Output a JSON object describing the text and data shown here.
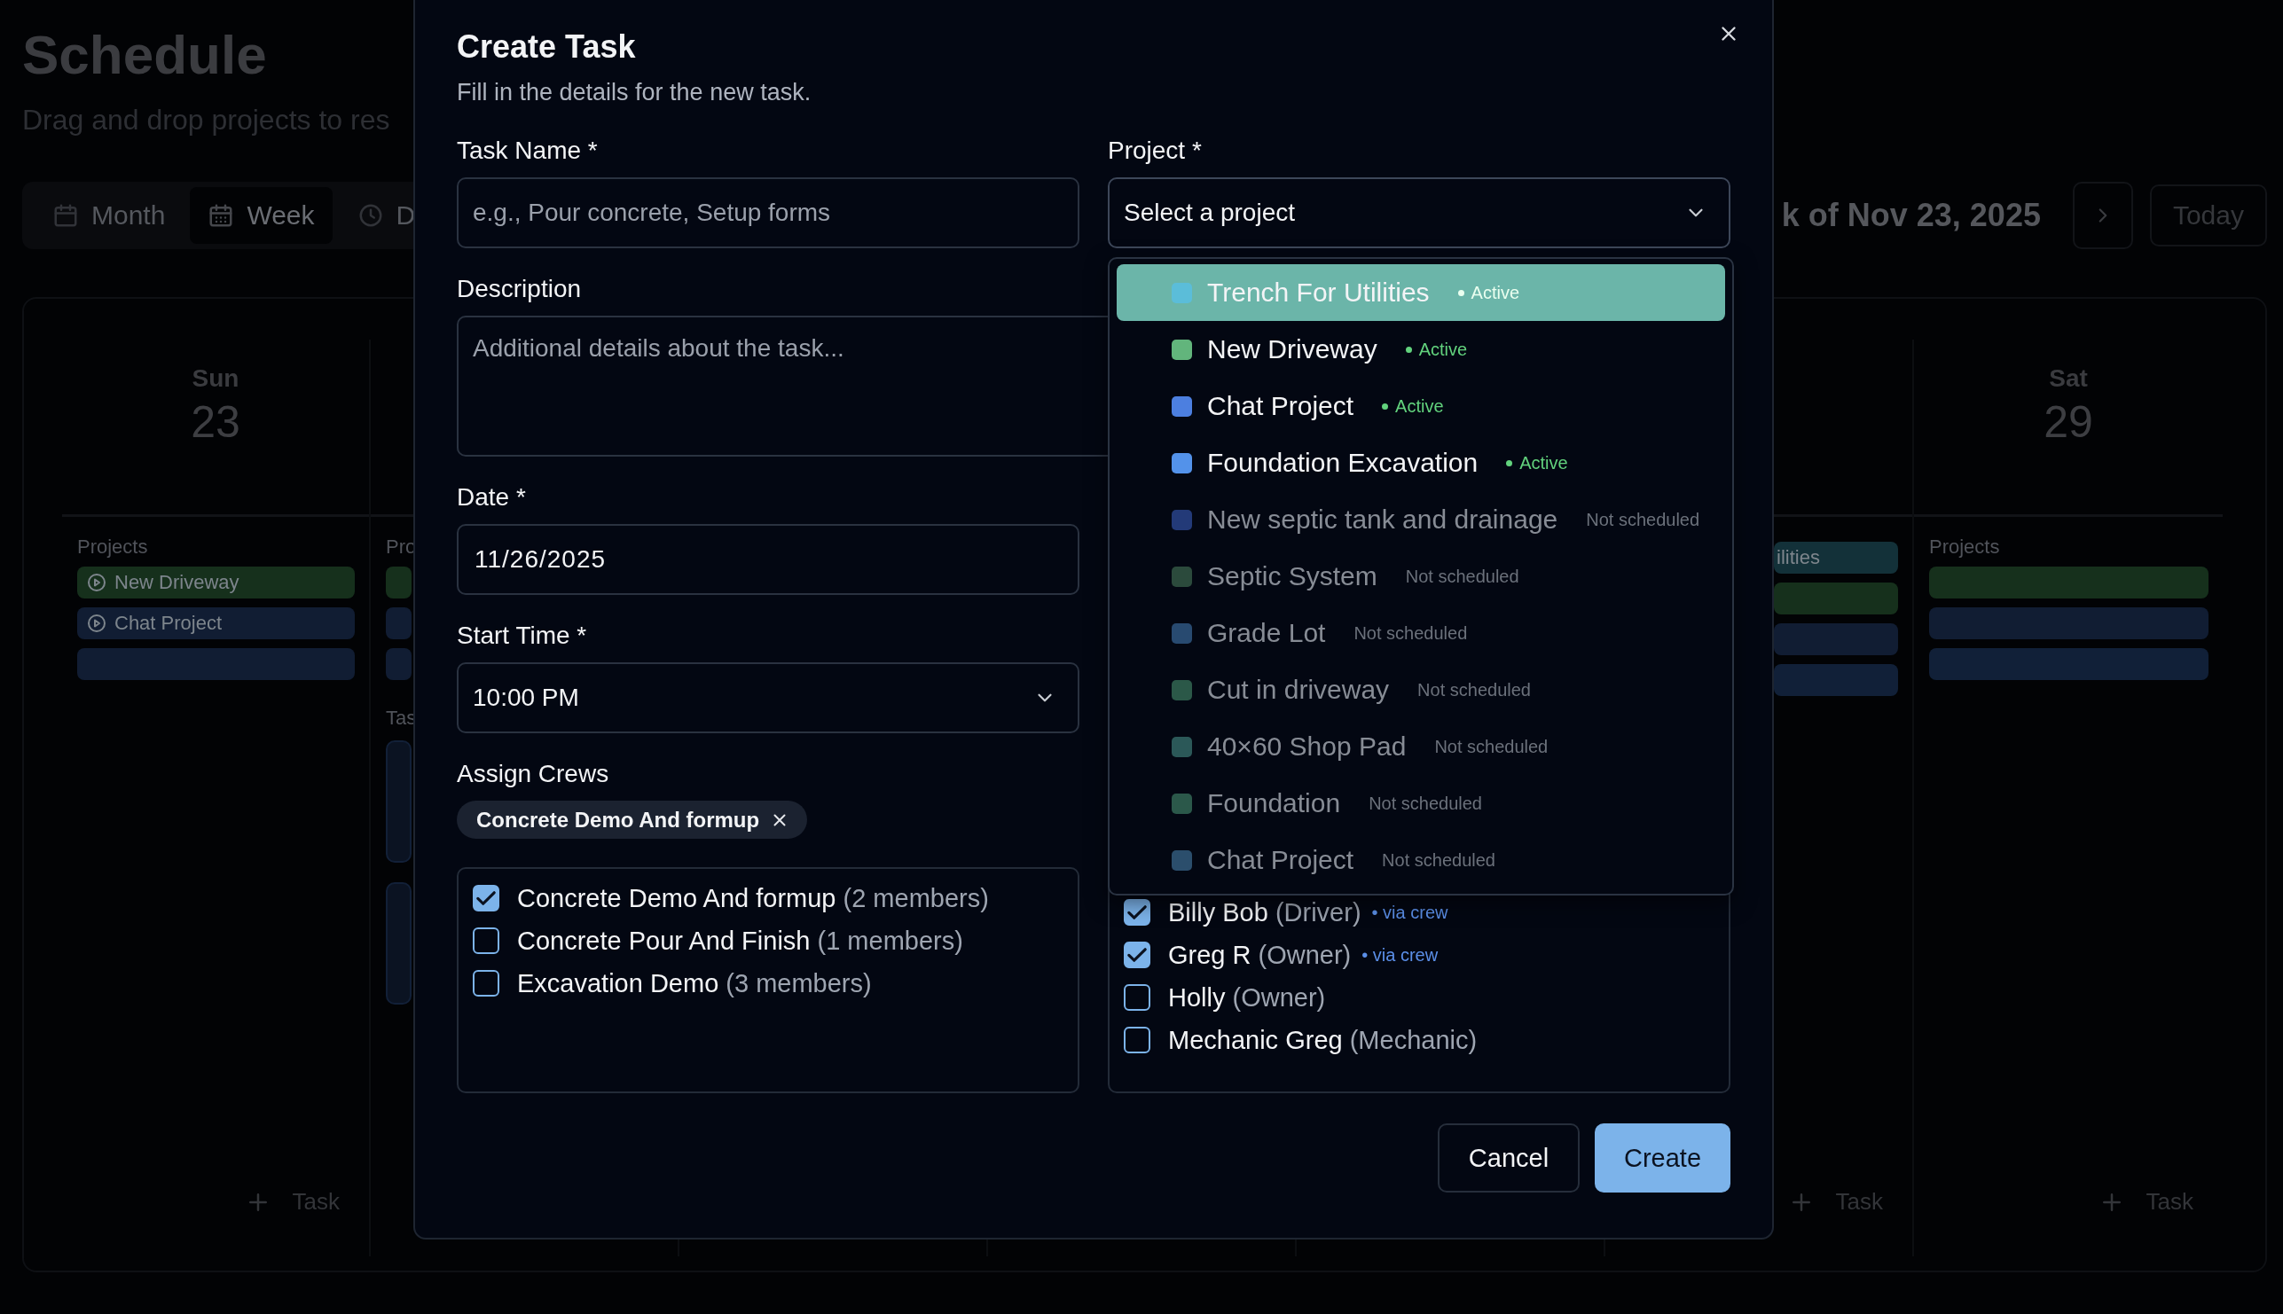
{
  "page": {
    "title": "Schedule",
    "subtitle": "Drag and drop projects to res"
  },
  "view_tabs": [
    {
      "label": "Month",
      "selected": false
    },
    {
      "label": "Week",
      "selected": true
    },
    {
      "label": "D",
      "selected": false
    }
  ],
  "week_label": "k of Nov 23, 2025",
  "today_button": "Today",
  "calendar": {
    "days": [
      {
        "name": "Sun",
        "date": "23",
        "projects_label": "Projects",
        "projects": [
          {
            "label": "New Driveway",
            "color": "#16301c"
          },
          {
            "label": "Chat Project",
            "color": "#111d33"
          },
          {
            "color": "#111d33"
          }
        ],
        "add_task": "Task"
      },
      {
        "projects_label": "Pro",
        "projects": [
          {
            "color": "#16301c"
          },
          {
            "color": "#111d33"
          },
          {
            "color": "#111d33"
          }
        ],
        "tasks_label": "Tas",
        "tasks": [
          {
            "kind": "card"
          },
          {
            "kind": "card"
          }
        ]
      },
      {
        "projects": [
          {
            "label": "ilities",
            "color": "#133139"
          },
          {
            "color": "#16301c"
          },
          {
            "color": "#111d33"
          },
          {
            "color": "#112038"
          }
        ],
        "add_task": "Task"
      },
      {
        "name": "Sat",
        "date": "29",
        "projects_label": "Projects",
        "projects": [
          {
            "color": "#16301c"
          },
          {
            "color": "#111d33"
          },
          {
            "color": "#112038"
          }
        ],
        "add_task": "Task"
      }
    ]
  },
  "dialog": {
    "title": "Create Task",
    "subtitle": "Fill in the details for the new task.",
    "task_name": {
      "label": "Task Name *",
      "placeholder": "e.g., Pour concrete, Setup forms"
    },
    "project": {
      "label": "Project *",
      "placeholder": "Select a project",
      "expanded": true,
      "options": [
        {
          "name": "Trench For Utilities",
          "status": "Active",
          "active": true,
          "selected": true,
          "color": "#5bbdd9"
        },
        {
          "name": "New Driveway",
          "status": "Active",
          "active": true,
          "selected": false,
          "color": "#62b57c"
        },
        {
          "name": "Chat Project",
          "status": "Active",
          "active": true,
          "selected": false,
          "color": "#4c7fe0"
        },
        {
          "name": "Foundation Excavation",
          "status": "Active",
          "active": true,
          "selected": false,
          "color": "#5392ea"
        },
        {
          "name": "New septic tank and drainage",
          "status": "Not scheduled",
          "active": false,
          "selected": false,
          "color": "#233a78"
        },
        {
          "name": "Septic System",
          "status": "Not scheduled",
          "active": false,
          "selected": false,
          "color": "#2b4a3c"
        },
        {
          "name": "Grade Lot",
          "status": "Not scheduled",
          "active": false,
          "selected": false,
          "color": "#284a70"
        },
        {
          "name": "Cut in driveway",
          "status": "Not scheduled",
          "active": false,
          "selected": false,
          "color": "#2b5848"
        },
        {
          "name": "40×60 Shop Pad",
          "status": "Not scheduled",
          "active": false,
          "selected": false,
          "color": "#2b5858"
        },
        {
          "name": "Foundation",
          "status": "Not scheduled",
          "active": false,
          "selected": false,
          "color": "#2b584a"
        },
        {
          "name": "Chat Project",
          "status": "Not scheduled",
          "active": false,
          "selected": false,
          "color": "#2b4e6c"
        }
      ]
    },
    "description": {
      "label": "Description",
      "placeholder": "Additional details about the task..."
    },
    "date": {
      "label": "Date *",
      "value": "11/26/2025"
    },
    "start_time": {
      "label": "Start Time *",
      "value": "10:00 PM"
    },
    "crews": {
      "label": "Assign Crews",
      "chips": [
        "Concrete Demo And formup"
      ],
      "items": [
        {
          "name": "Concrete Demo And formup",
          "detail": "(2 members)",
          "checked": true
        },
        {
          "name": "Concrete Pour And Finish",
          "detail": "(1 members)",
          "checked": false
        },
        {
          "name": "Excavation Demo",
          "detail": "(3 members)",
          "checked": false
        }
      ]
    },
    "members": {
      "items": [
        {
          "name": "Billy Bob",
          "detail": "(Driver)",
          "note": "• via crew",
          "checked": true
        },
        {
          "name": "Greg R",
          "detail": "(Owner)",
          "note": "• via crew",
          "checked": true
        },
        {
          "name": "Holly",
          "detail": "(Owner)",
          "checked": false
        },
        {
          "name": "Mechanic Greg",
          "detail": "(Mechanic)",
          "checked": false
        }
      ]
    },
    "buttons": [
      {
        "label": "Cancel",
        "kind": "secondary"
      },
      {
        "label": "Create",
        "kind": "primary"
      }
    ]
  }
}
